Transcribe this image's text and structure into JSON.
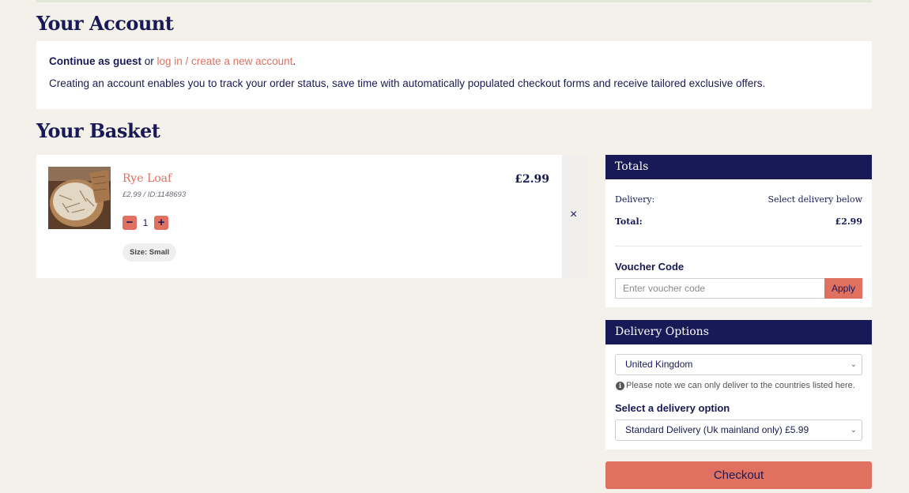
{
  "account": {
    "heading": "Your Account",
    "guest_label": "Continue as guest",
    "or_text": " or ",
    "login_link": "log in / create a new account",
    "period": ".",
    "benefits": "Creating an account enables you to track your order status, save time with automatically populated checkout forms and receive tailored exclusive offers."
  },
  "basket": {
    "heading": "Your Basket",
    "items": [
      {
        "name": "Rye Loaf",
        "meta": "£2.99 /  ID:1148693",
        "price": "£2.99",
        "quantity": "1",
        "size": "Size: Small",
        "remove_icon": "close-icon",
        "image": "rye-loaf-photo"
      }
    ],
    "decrement_symbol": "−",
    "increment_symbol": "+",
    "remove_symbol": "×"
  },
  "totals": {
    "heading": "Totals",
    "delivery_label": "Delivery:",
    "delivery_value": "Select delivery below",
    "total_label": "Total:",
    "total_value": "£2.99"
  },
  "voucher": {
    "label": "Voucher Code",
    "placeholder": "Enter voucher code",
    "apply_label": "Apply"
  },
  "delivery": {
    "heading": "Delivery Options",
    "country": "United Kingdom",
    "note": "Please note we can only deliver to the countries listed here.",
    "option_label": "Select a delivery option",
    "option_value": "Standard Delivery (Uk mainland only) £5.99"
  },
  "checkout_label": "Checkout",
  "colors": {
    "navy": "#171a57",
    "coral": "#e07161",
    "background": "#f4f0ea"
  }
}
